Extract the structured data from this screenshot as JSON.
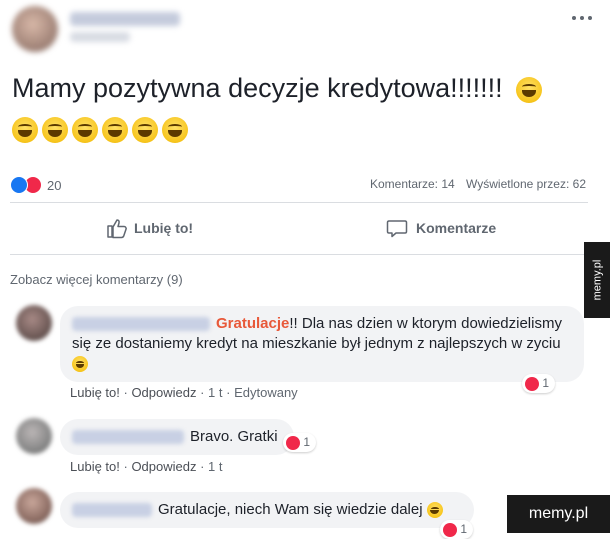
{
  "post": {
    "text": "Mamy pozytywna decyzje kredytowa!!!!!!!",
    "more_icon": "more-horizontal-icon",
    "emoji_name": "grinning-face-emoji"
  },
  "stats": {
    "reaction_count": "20",
    "comments": "Komentarze: 14",
    "views": "Wyświetlone przez: 62"
  },
  "actions": {
    "like_label": "Lubię to!",
    "comment_label": "Komentarze"
  },
  "comments_section": {
    "view_more": "Zobacz więcej komentarzy (9)",
    "items": [
      {
        "highlight": "Gratulacje",
        "text": "!! Dla nas dzien w ktorym dowiedzielismy się ze dostaniemy kredyt na mieszkanie był jednym z najlepszych w zyciu",
        "reactions": "1",
        "like": "Lubię to!",
        "reply": "Odpowiedz",
        "time": "1 t",
        "edited": "Edytowany"
      },
      {
        "text": "Bravo. Gratki",
        "reactions": "1",
        "like": "Lubię to!",
        "reply": "Odpowiedz",
        "time": "1 t"
      },
      {
        "text": "Gratulacje, niech Wam się wiedzie dalej",
        "reactions": "1"
      }
    ]
  },
  "watermarks": {
    "side": "memy.pl",
    "corner": "memy.pl"
  },
  "colors": {
    "highlight": "#e8593a",
    "like_blue": "#1877f2",
    "love_red": "#f0284a"
  }
}
